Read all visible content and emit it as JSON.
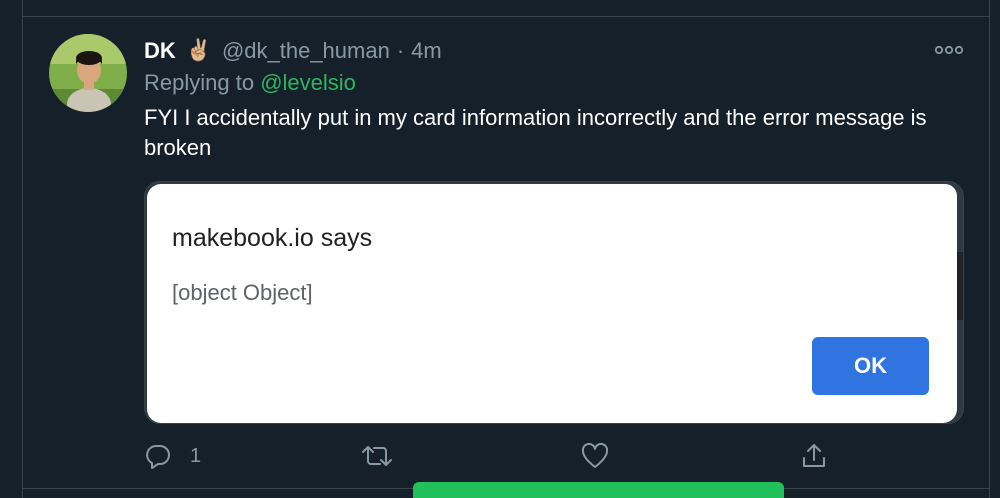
{
  "tweet": {
    "display_name": "DK",
    "emoji": "✌🏼",
    "handle": "@dk_the_human",
    "separator": "·",
    "time": "4m",
    "replying_prefix": "Replying to ",
    "replying_to": "@levelsio",
    "text": "FYI I accidentally put in my card information incorrectly and the error message is broken"
  },
  "dialog": {
    "title": "makebook.io says",
    "message": "[object Object]",
    "ok_label": "OK"
  },
  "actions": {
    "reply_icon": "reply-icon",
    "reply_count": "1",
    "retweet_icon": "retweet-icon",
    "like_icon": "heart-icon",
    "share_icon": "share-icon"
  },
  "colors": {
    "background": "#15202b",
    "secondary_text": "#8899a6",
    "mention": "#2cb65d",
    "dialog_button": "#2f74e0"
  }
}
